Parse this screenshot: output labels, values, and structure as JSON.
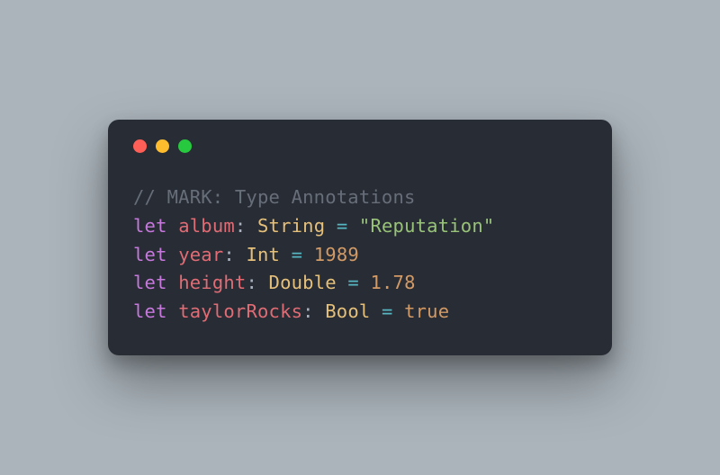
{
  "colors": {
    "background": "#abb4bb",
    "editor_bg": "#282c34",
    "traffic_red": "#ff5f56",
    "traffic_yellow": "#ffbd2e",
    "traffic_green": "#27c93f",
    "comment": "#676e79",
    "keyword": "#c678dd",
    "identifier": "#e06c75",
    "type": "#e5c07b",
    "string": "#98c379",
    "number": "#d19a66",
    "operator": "#56b6c2",
    "punctuation": "#abb2bf"
  },
  "code": {
    "language": "swift",
    "lines": [
      {
        "kind": "comment",
        "text": "// MARK: Type Annotations"
      },
      {
        "kind": "decl",
        "keyword": "let",
        "name": "album",
        "type": "String",
        "value": "\"Reputation\"",
        "value_kind": "string"
      },
      {
        "kind": "decl",
        "keyword": "let",
        "name": "year",
        "type": "Int",
        "value": "1989",
        "value_kind": "number"
      },
      {
        "kind": "decl",
        "keyword": "let",
        "name": "height",
        "type": "Double",
        "value": "1.78",
        "value_kind": "number"
      },
      {
        "kind": "decl",
        "keyword": "let",
        "name": "taylorRocks",
        "type": "Bool",
        "value": "true",
        "value_kind": "bool"
      }
    ]
  }
}
